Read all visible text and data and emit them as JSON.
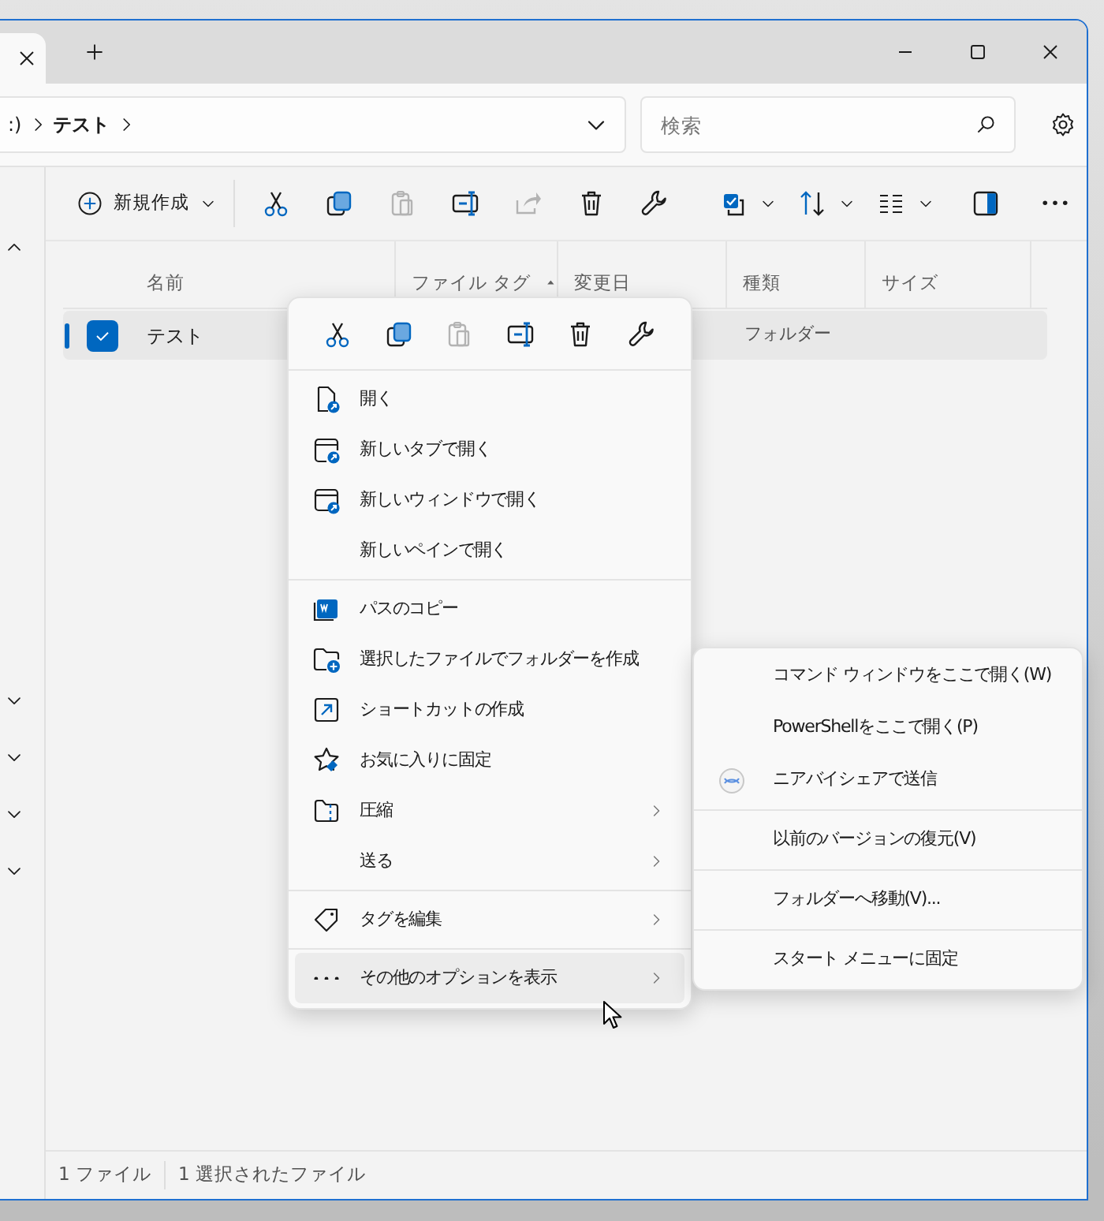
{
  "address_bar": {
    "segments": [
      ":)",
      "テスト"
    ]
  },
  "search": {
    "placeholder": "検索"
  },
  "toolbar": {
    "new_button": {
      "label": "新規作成"
    },
    "buttons": [
      {
        "disabled": false,
        "dropdown": false
      },
      {
        "disabled": false,
        "dropdown": false
      },
      {
        "disabled": true,
        "dropdown": false
      },
      {
        "disabled": false,
        "dropdown": false
      },
      {
        "disabled": true,
        "dropdown": false
      },
      {
        "disabled": false,
        "dropdown": false
      },
      {
        "disabled": false,
        "dropdown": false
      },
      {
        "disabled": false,
        "dropdown": true
      },
      {
        "disabled": false,
        "dropdown": true
      },
      {
        "disabled": false,
        "dropdown": true
      },
      {
        "disabled": false,
        "dropdown": false
      },
      {
        "disabled": false,
        "dropdown": false
      }
    ]
  },
  "sidebar": {
    "toggles": [
      {
        "expanded": true
      },
      {
        "expanded": false
      },
      {
        "expanded": false
      },
      {
        "expanded": false
      },
      {
        "expanded": false
      }
    ]
  },
  "table": {
    "columns": [
      {
        "label": "名前",
        "sorted": false
      },
      {
        "label": "ファイル タグ",
        "sorted": true
      },
      {
        "label": "変更日",
        "sorted": false
      },
      {
        "label": "種類",
        "sorted": false
      },
      {
        "label": "サイズ",
        "sorted": false
      }
    ],
    "rows": [
      {
        "name": "テスト",
        "type": "フォルダー",
        "checked": true,
        "selected": true
      }
    ]
  },
  "status_bar": [
    "1 ファイル",
    "1 選択されたファイル"
  ],
  "context_menu": {
    "quick_actions": [
      {
        "disabled": false
      },
      {
        "disabled": false
      },
      {
        "disabled": true
      },
      {
        "disabled": false
      },
      {
        "disabled": false
      },
      {
        "disabled": false
      }
    ],
    "items": [
      {
        "kind": "item",
        "label": "開く",
        "submenu": false,
        "highlighted": false
      },
      {
        "kind": "item",
        "label": "新しいタブで開く",
        "submenu": false,
        "highlighted": false
      },
      {
        "kind": "item",
        "label": "新しいウィンドウで開く",
        "submenu": false,
        "highlighted": false
      },
      {
        "kind": "item",
        "label": "新しいペインで開く",
        "submenu": false,
        "highlighted": false
      },
      {
        "kind": "separator"
      },
      {
        "kind": "item",
        "label": "パスのコピー",
        "submenu": false,
        "highlighted": false
      },
      {
        "kind": "item",
        "label": "選択したファイルでフォルダーを作成",
        "submenu": false,
        "highlighted": false
      },
      {
        "kind": "item",
        "label": "ショートカットの作成",
        "submenu": false,
        "highlighted": false
      },
      {
        "kind": "item",
        "label": "お気に入りに固定",
        "submenu": false,
        "highlighted": false
      },
      {
        "kind": "item",
        "label": "圧縮",
        "submenu": true,
        "highlighted": false
      },
      {
        "kind": "item",
        "label": "送る",
        "submenu": true,
        "highlighted": false
      },
      {
        "kind": "separator"
      },
      {
        "kind": "item",
        "label": "タグを編集",
        "submenu": true,
        "highlighted": false
      },
      {
        "kind": "separator"
      },
      {
        "kind": "item",
        "label": "その他のオプションを表示",
        "submenu": true,
        "highlighted": true
      }
    ]
  },
  "submenu": {
    "items": [
      {
        "kind": "item",
        "label": "コマンド ウィンドウをここで開く(W)"
      },
      {
        "kind": "item",
        "label": "PowerShellをここで開く(P)"
      },
      {
        "kind": "item",
        "label": "ニアバイシェアで送信"
      },
      {
        "kind": "separator"
      },
      {
        "kind": "item",
        "label": "以前のバージョンの復元(V)"
      },
      {
        "kind": "separator"
      },
      {
        "kind": "item",
        "label": "フォルダーへ移動(V)..."
      },
      {
        "kind": "separator"
      },
      {
        "kind": "item",
        "label": "スタート メニューに固定"
      }
    ]
  }
}
